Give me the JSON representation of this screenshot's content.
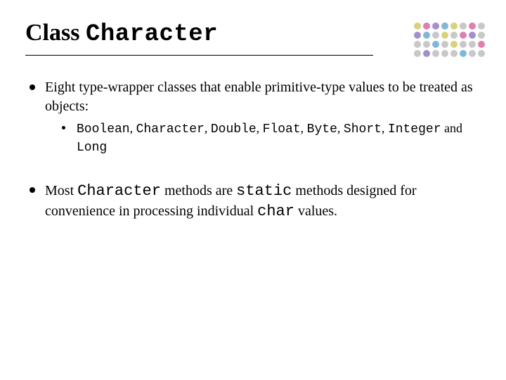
{
  "title": {
    "prefix": "Class ",
    "code": "Character"
  },
  "dots": {
    "colors": [
      "#d9d27a",
      "#e07fb0",
      "#a48fce",
      "#7fb8d9",
      "#d9d27a",
      "#c8c8c8",
      "#e07fb0",
      "#c8c8c8",
      "#a48fce",
      "#7fb8d9",
      "#c8c8c8",
      "#d9d27a",
      "#c8c8c8",
      "#e07fb0",
      "#a48fce",
      "#c8c8c8",
      "#c8c8c8",
      "#c8c8c8",
      "#7fb8d9",
      "#c8c8c8",
      "#d9d27a",
      "#c8c8c8",
      "#c8c8c8",
      "#e07fb0",
      "#c8c8c8",
      "#a48fce",
      "#c8c8c8",
      "#c8c8c8",
      "#c8c8c8",
      "#7fb8d9",
      "#c8c8c8",
      "#c8c8c8"
    ]
  },
  "bullets": [
    {
      "text": "Eight type-wrapper classes that enable primitive-type values to be treated as objects:",
      "sub": [
        {
          "segments": [
            {
              "t": "Boolean",
              "c": true
            },
            {
              "t": ", ",
              "c": false
            },
            {
              "t": "Character",
              "c": true
            },
            {
              "t": ", ",
              "c": false
            },
            {
              "t": "Double",
              "c": true
            },
            {
              "t": ", ",
              "c": false
            },
            {
              "t": "Float",
              "c": true
            },
            {
              "t": ", ",
              "c": false
            },
            {
              "t": "Byte",
              "c": true
            },
            {
              "t": ", ",
              "c": false
            },
            {
              "t": "Short",
              "c": true
            },
            {
              "t": ", ",
              "c": false
            },
            {
              "t": "Integer",
              "c": true
            },
            {
              "t": " and ",
              "c": false
            },
            {
              "t": "Long",
              "c": true
            }
          ]
        }
      ]
    },
    {
      "segments": [
        {
          "t": "Most ",
          "c": false
        },
        {
          "t": "Character",
          "c": true,
          "lg": true
        },
        {
          "t": " methods are ",
          "c": false
        },
        {
          "t": "static",
          "c": true,
          "lg": true
        },
        {
          "t": " methods designed for convenience in processing individual ",
          "c": false
        },
        {
          "t": "char",
          "c": true,
          "lg": true
        },
        {
          "t": " values.",
          "c": false
        }
      ]
    }
  ]
}
